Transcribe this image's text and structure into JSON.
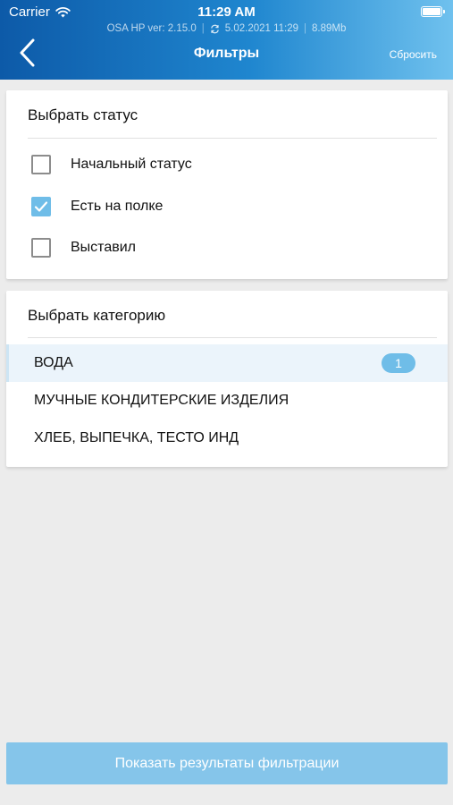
{
  "status_bar": {
    "carrier": "Carrier",
    "time": "11:29 AM"
  },
  "info_line": {
    "version": "OSA HP ver: 2.15.0",
    "sync_time": "5.02.2021 11:29",
    "size": "8.89Mb"
  },
  "nav": {
    "title": "Фильтры",
    "reset_label": "Сбросить"
  },
  "status_section": {
    "title": "Выбрать статус",
    "options": [
      {
        "label": "Начальный статус",
        "checked": false
      },
      {
        "label": "Есть на полке",
        "checked": true
      },
      {
        "label": "Выставил",
        "checked": false
      }
    ]
  },
  "category_section": {
    "title": "Выбрать категорию",
    "items": [
      {
        "label": "ВОДА",
        "count": "1",
        "selected": true
      },
      {
        "label": "МУЧНЫЕ КОНДИТЕРСКИЕ ИЗДЕЛИЯ"
      },
      {
        "label": "ХЛЕБ, ВЫПЕЧКА, ТЕСТО ИНД"
      }
    ]
  },
  "footer": {
    "show_results_label": "Показать результаты фильтрации"
  },
  "colors": {
    "accent": "#6fbde8",
    "header_start": "#0d5aa8",
    "header_end": "#6fc1ee",
    "button": "#85c5ea"
  },
  "icons": {
    "back": "chevron-left-icon",
    "wifi": "wifi-icon",
    "battery": "battery-icon",
    "sync": "sync-icon",
    "check": "checkmark-icon"
  }
}
